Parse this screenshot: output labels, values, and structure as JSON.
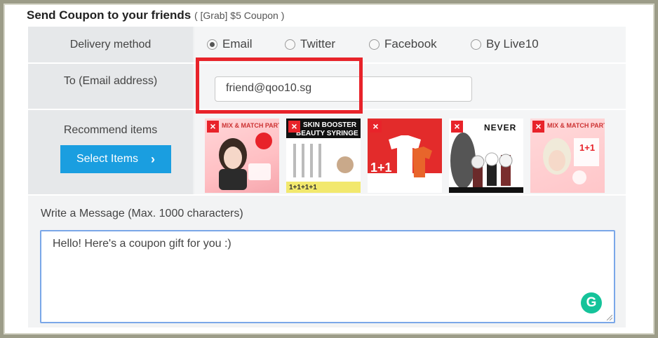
{
  "header": {
    "title": "Send Coupon to your friends",
    "subtitle": "( [Grab] $5 Coupon )"
  },
  "delivery": {
    "label": "Delivery method",
    "options": [
      "Email",
      "Twitter",
      "Facebook",
      "By Live10"
    ],
    "selected": "Email"
  },
  "recipient": {
    "label": "To (Email address)",
    "value": "friend@qoo10.sg"
  },
  "recommend": {
    "label": "Recommend items",
    "button_label": "Select Items",
    "items": [
      {
        "caption": "MIX & MATCH PARTY"
      },
      {
        "caption_top": "SKIN BOOSTER",
        "caption_mid": "BEAUTY SYRINGE",
        "caption_bottom": "1+1+1+1"
      },
      {
        "caption": "1+1"
      },
      {
        "caption": "NEVER"
      },
      {
        "caption_top": "MIX & MATCH PARTY",
        "caption_mid": "1+1"
      }
    ]
  },
  "message": {
    "label": "Write a Message (Max. 1000 characters)",
    "value": "Hello! Here's a coupon gift for you :)"
  },
  "colors": {
    "accent": "#1a9ee0",
    "highlight": "#e8232a",
    "grammarly": "#15c39a"
  }
}
